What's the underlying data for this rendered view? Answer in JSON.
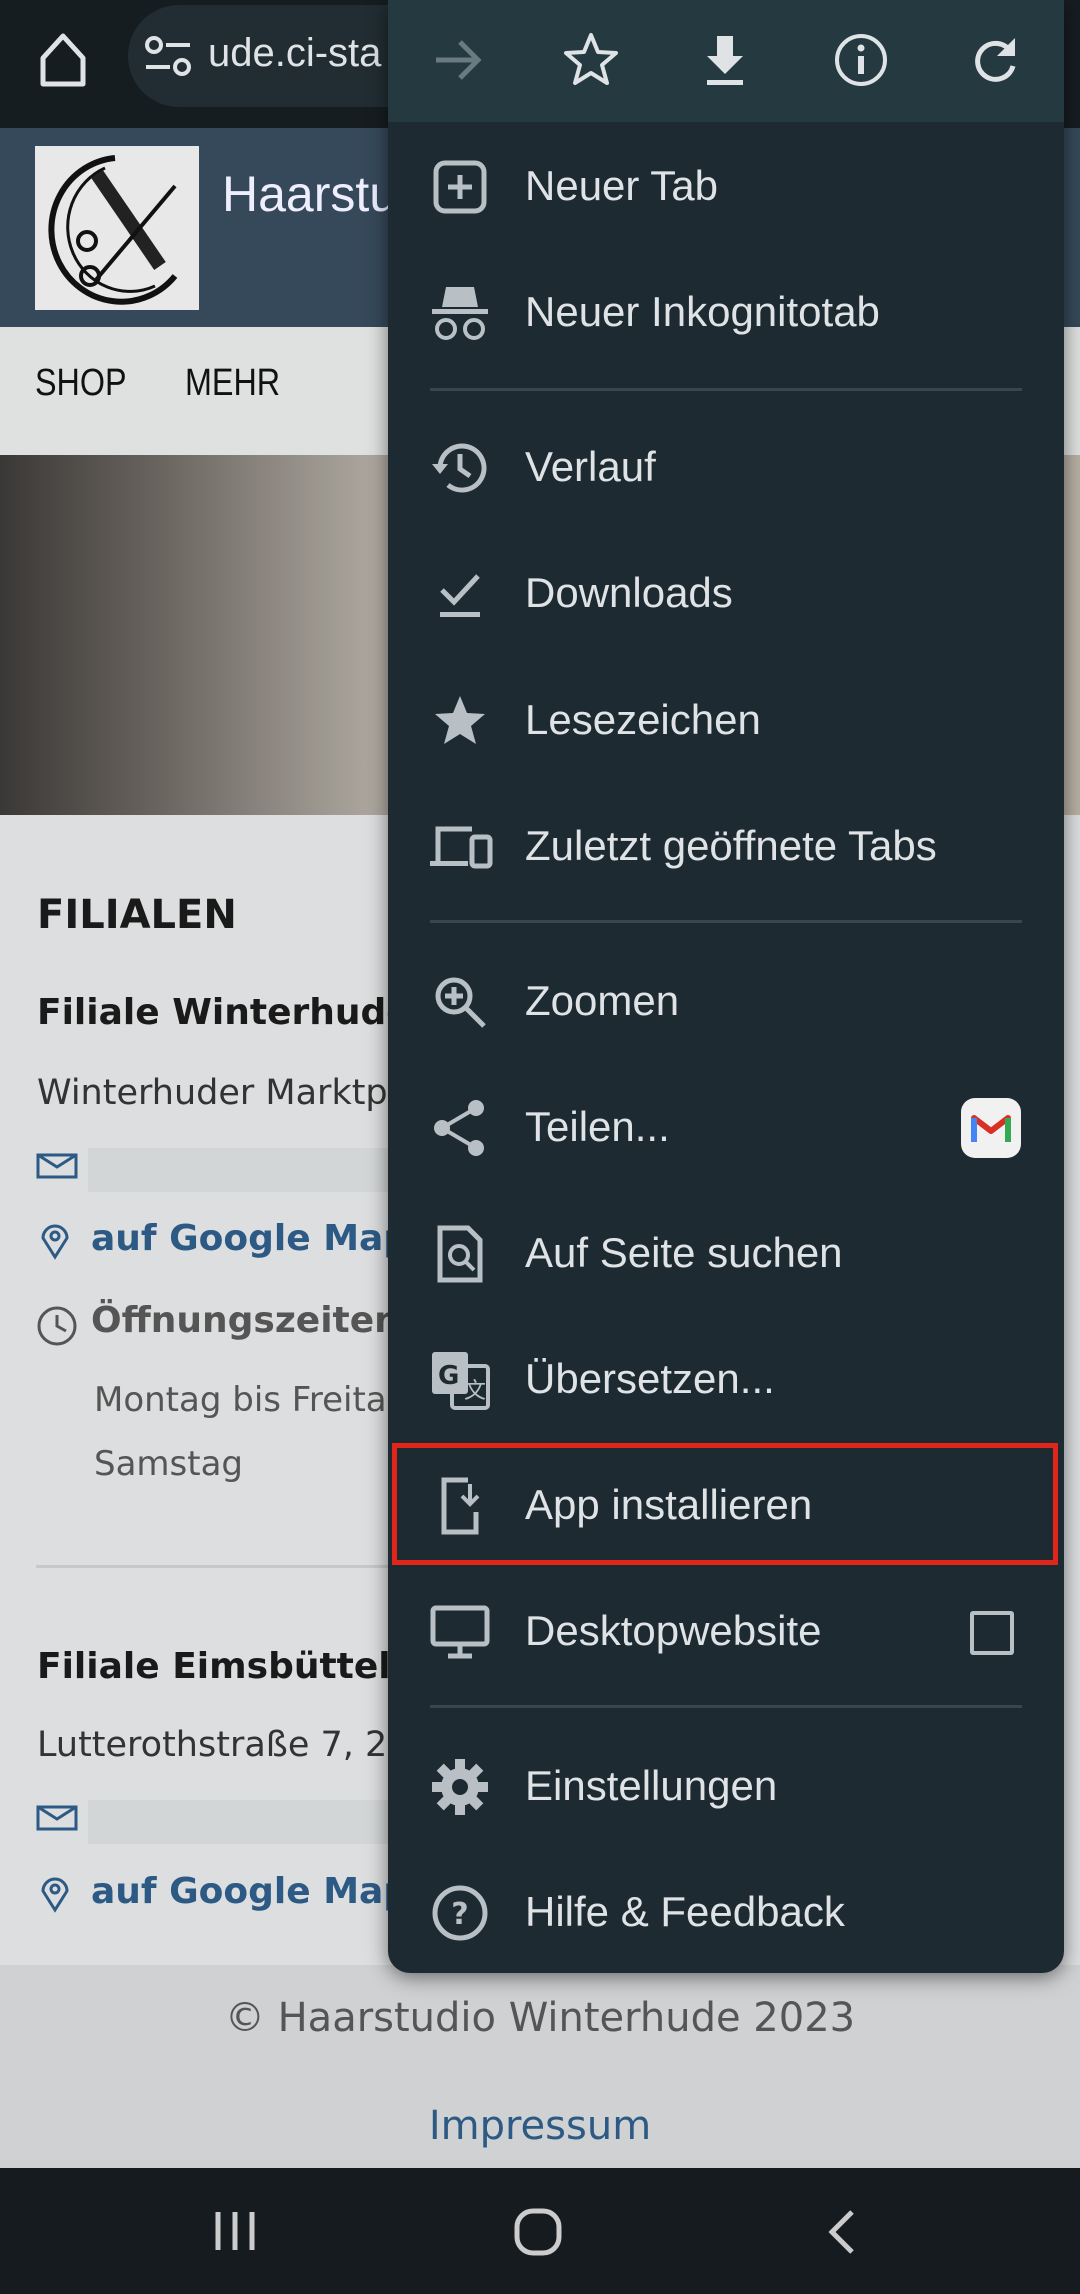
{
  "browser": {
    "url": "ude.ci-sta"
  },
  "site": {
    "title": "Haarstu",
    "nav": [
      "SHOP",
      "MEHR"
    ],
    "section_title": "FILIALEN",
    "branches": [
      {
        "name": "Filiale Winterhude",
        "address": "Winterhuder Marktp",
        "maps_link": "auf Google Maps a",
        "hours_label": "Öffnungszeiten",
        "hours": [
          "Montag bis Freita",
          "Samstag"
        ]
      },
      {
        "name": "Filiale Eimsbüttel",
        "address": "Lutterothstraße 7, 2",
        "maps_link": "auf Google Maps a"
      }
    ],
    "footer": {
      "copyright": "© Haarstudio Winterhude 2023",
      "impressum": "Impressum"
    }
  },
  "menu": {
    "top_icons": [
      "forward-icon",
      "bookmark-star-icon",
      "download-icon",
      "info-icon",
      "reload-icon"
    ],
    "items": [
      {
        "label": "Neuer Tab",
        "icon": "new-tab-icon"
      },
      {
        "label": "Neuer Inkognitotab",
        "icon": "incognito-icon"
      },
      {
        "label": "Verlauf",
        "icon": "history-icon"
      },
      {
        "label": "Downloads",
        "icon": "downloads-icon"
      },
      {
        "label": "Lesezeichen",
        "icon": "bookmarks-icon"
      },
      {
        "label": "Zuletzt geöffnete Tabs",
        "icon": "recent-tabs-icon"
      },
      {
        "label": "Zoomen",
        "icon": "zoom-icon"
      },
      {
        "label": "Teilen...",
        "icon": "share-icon"
      },
      {
        "label": "Auf Seite suchen",
        "icon": "find-in-page-icon"
      },
      {
        "label": "Übersetzen...",
        "icon": "translate-icon"
      },
      {
        "label": "App installieren",
        "icon": "install-app-icon",
        "highlighted": true
      },
      {
        "label": "Desktopwebsite",
        "icon": "desktop-icon",
        "checkbox": false
      },
      {
        "label": "Einstellungen",
        "icon": "settings-icon"
      },
      {
        "label": "Hilfe & Feedback",
        "icon": "help-icon"
      }
    ],
    "highlight_color": "#e0251b"
  }
}
